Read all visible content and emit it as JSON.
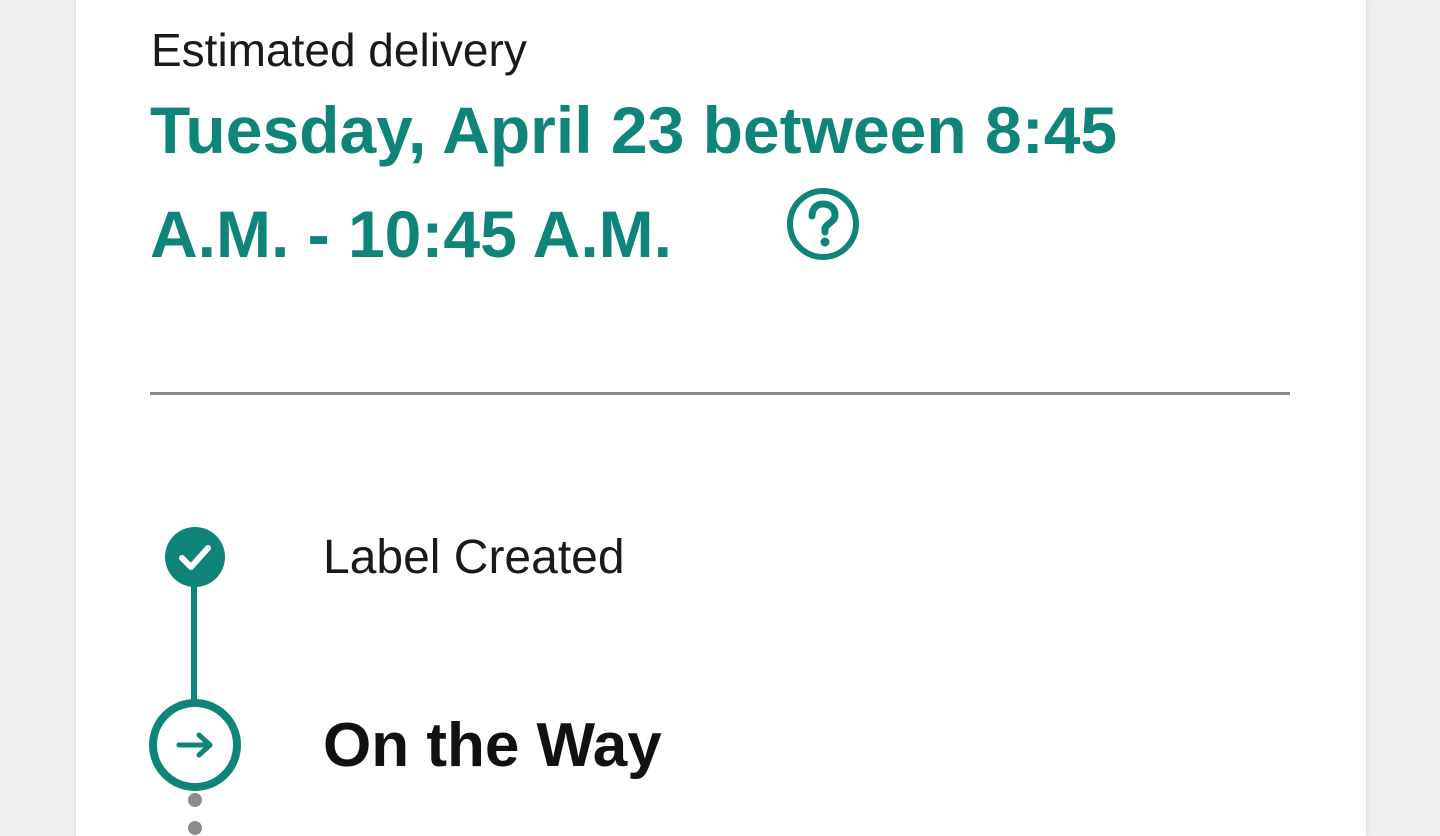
{
  "delivery": {
    "label": "Estimated delivery",
    "window_line1": "Tuesday, April 23 between 8:45",
    "window_line2": "A.M. - 10:45 A.M.",
    "help_icon": "question-circle-icon"
  },
  "timeline": {
    "steps": [
      {
        "label": "Label Created",
        "status": "completed",
        "icon": "check-circle-icon"
      },
      {
        "label": "On the Way",
        "status": "current",
        "icon": "arrow-right-circle-icon"
      }
    ]
  },
  "colors": {
    "accent": "#0f8478",
    "text": "#1a1a1a",
    "divider": "#8c8c8c",
    "background": "#efefef",
    "card": "#ffffff"
  }
}
